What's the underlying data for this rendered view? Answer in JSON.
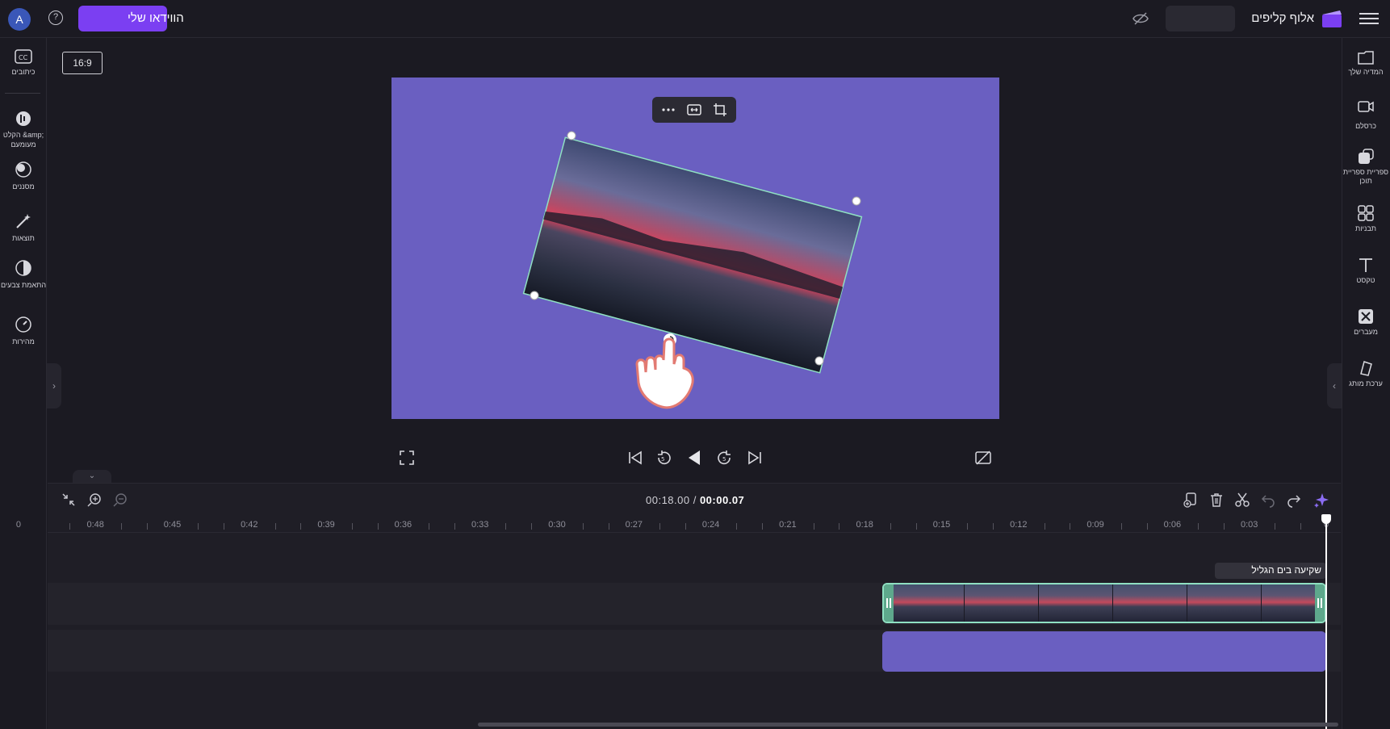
{
  "topbar": {
    "app_name": "אלוף קליפים",
    "export_label": "הווידאו שלי",
    "help_symbol": "?",
    "avatar_initial": "A"
  },
  "left_sidebar": {
    "items": [
      {
        "icon": "captions-icon",
        "label": "כיתובים"
      },
      {
        "icon": "audio-text-icon",
        "label": "הקלט &amp; מעומעם"
      },
      {
        "icon": "filters-icon",
        "label": "מסננים"
      },
      {
        "icon": "effects-icon",
        "label": "תוצאות"
      },
      {
        "icon": "color-adjust-icon",
        "label": "התאמת צבעים"
      },
      {
        "icon": "speed-icon",
        "label": "מהירות"
      }
    ],
    "collapse_symbol": "›"
  },
  "right_sidebar": {
    "items": [
      {
        "icon": "your-media-icon",
        "label": "המדיה שלך"
      },
      {
        "icon": "record-create-icon",
        "label": "כרסלם"
      },
      {
        "icon": "content-library-icon",
        "label": "ספריית ספריית תוכן"
      },
      {
        "icon": "templates-icon",
        "label": "תבניות"
      },
      {
        "icon": "text-icon",
        "label": "טקסט"
      },
      {
        "icon": "transitions-icon",
        "label": "מעברים"
      },
      {
        "icon": "brand-kit-icon",
        "label": "ערכת מותג"
      }
    ],
    "collapse_symbol": "‹"
  },
  "stage": {
    "aspect_ratio": "16:9",
    "canvas_color": "#6a5fc1"
  },
  "timeline": {
    "current_time": "00:00.07",
    "total_time": "00:18.00",
    "separator": " / ",
    "ticks": [
      "0",
      "0:03",
      "0:06",
      "0:09",
      "0:12",
      "0:15",
      "0:18",
      "0:21",
      "0:24",
      "0:27",
      "0:30",
      "0:33",
      "0:36",
      "0:39",
      "0:42",
      "0:45",
      "0:48",
      "0"
    ],
    "clip_name": "שקיעה בים הגליל",
    "collapse_symbol": "⌄"
  }
}
